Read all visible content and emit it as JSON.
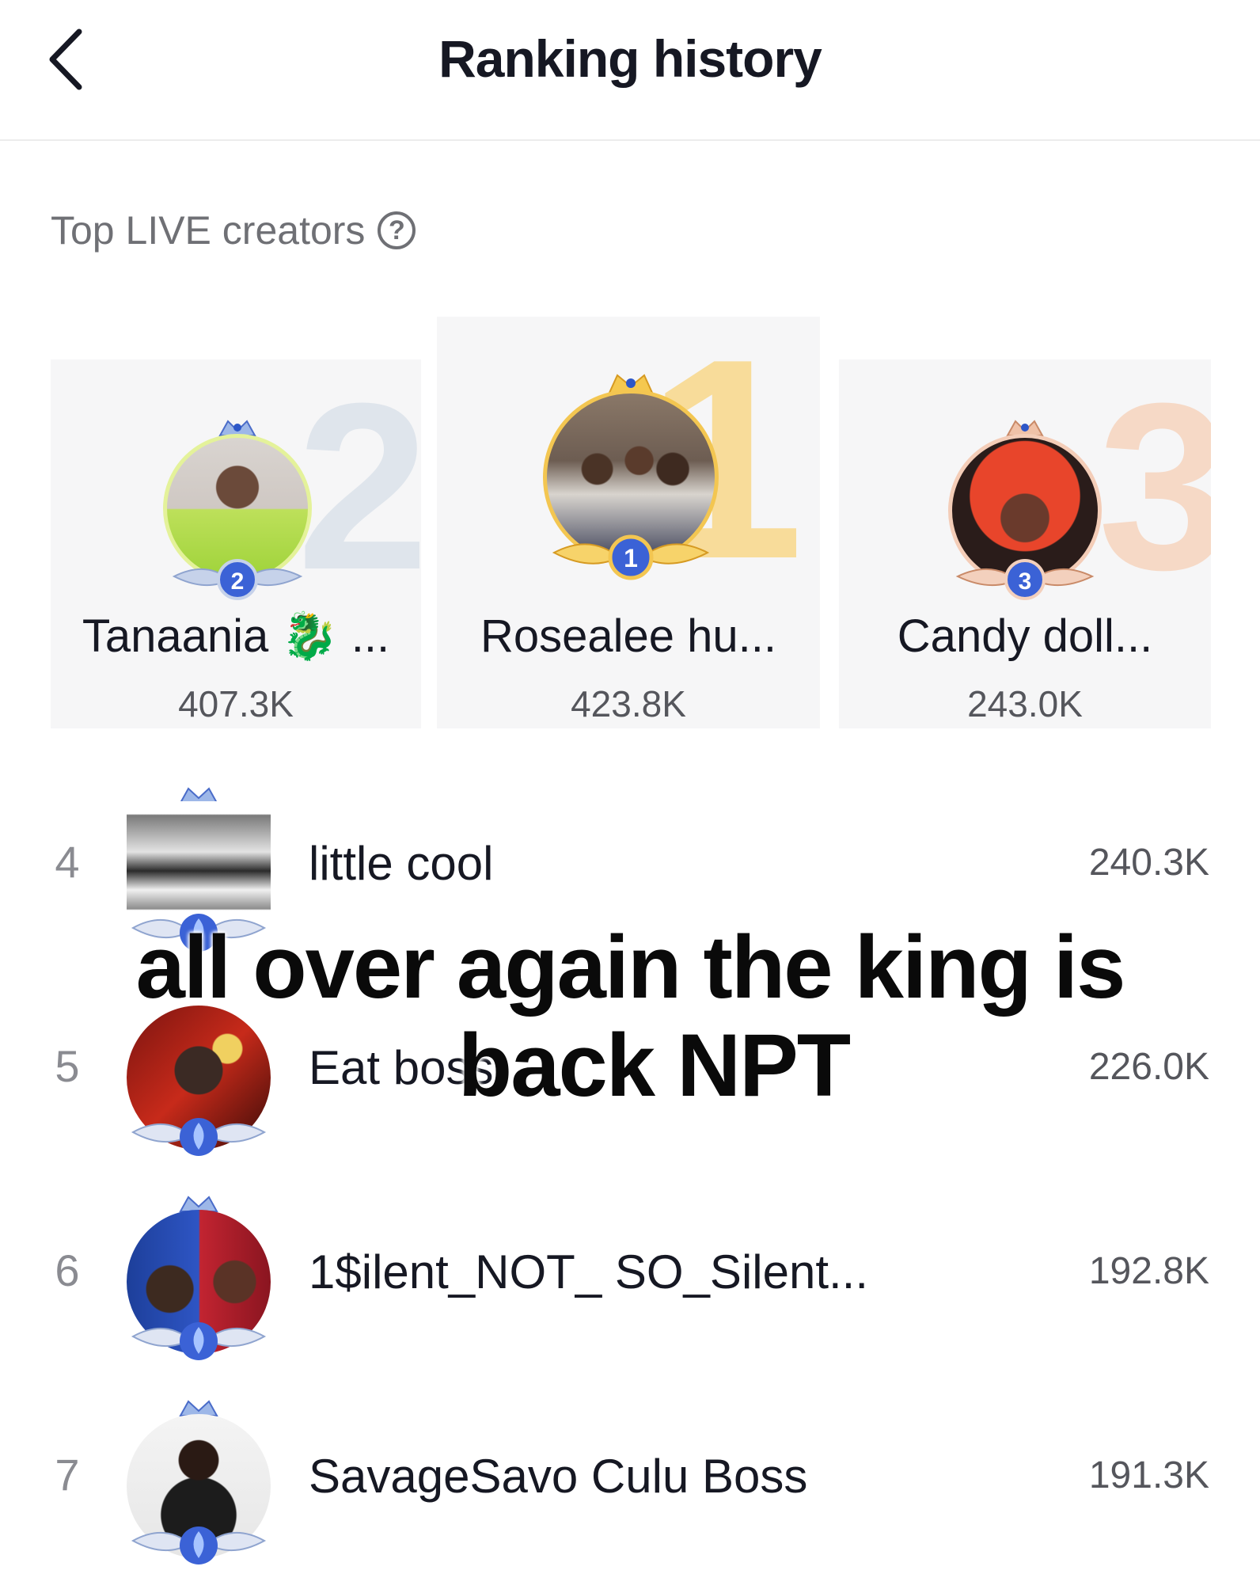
{
  "header": {
    "title": "Ranking history"
  },
  "section": {
    "title": "Top LIVE creators"
  },
  "podium": [
    {
      "rank": "2",
      "big_digit": "2",
      "name": "Tanaania 🐉 ...",
      "score": "407.3K"
    },
    {
      "rank": "1",
      "big_digit": "1",
      "name": "Rosealee hu...",
      "score": "423.8K"
    },
    {
      "rank": "3",
      "big_digit": "3",
      "name": "Candy doll...",
      "score": "243.0K"
    }
  ],
  "list": [
    {
      "rank": "4",
      "name": "little cool",
      "score": "240.3K"
    },
    {
      "rank": "5",
      "name": "Eat boss",
      "score": "226.0K"
    },
    {
      "rank": "6",
      "name": "1$ilent_NOT_ SO_Silent...",
      "score": "192.8K"
    },
    {
      "rank": "7",
      "name": "SavageSavo Culu Boss",
      "score": "191.3K"
    }
  ],
  "overlay": {
    "line1": "all over again the king is",
    "line2": "back NPT"
  },
  "colors": {
    "gold": "#f4c14a",
    "silver": "#c9d3df",
    "bronze": "#e9b08c",
    "badge_blue": "#3b62d6"
  }
}
